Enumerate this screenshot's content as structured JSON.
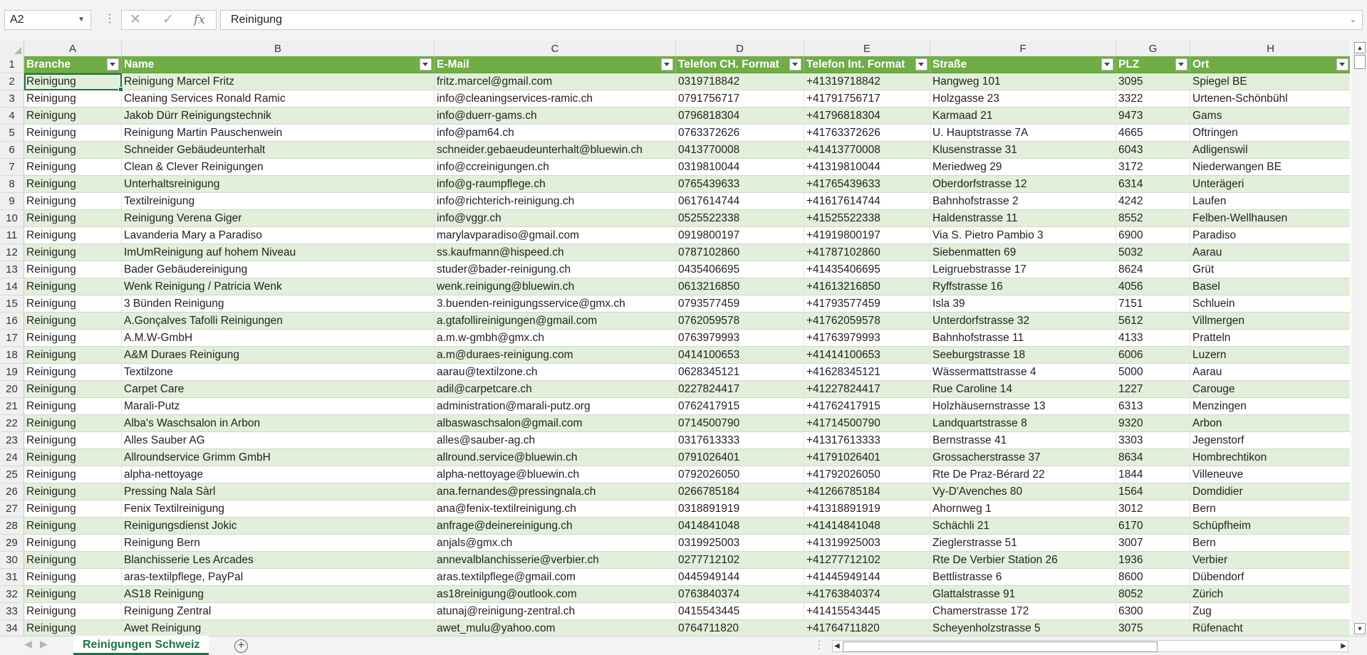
{
  "formula_bar": {
    "name_box": "A2",
    "more_icon": "⋮",
    "cancel_icon": "✕",
    "enter_icon": "✓",
    "fx_icon": "fx",
    "formula": "Reinigung"
  },
  "columns": [
    "A",
    "B",
    "C",
    "D",
    "E",
    "F",
    "G",
    "H"
  ],
  "table": {
    "headers": [
      "Branche",
      "Name",
      "E-Mail",
      "Telefon CH. Format",
      "Telefon Int. Format",
      "Straße",
      "PLZ",
      "Ort"
    ],
    "rows": [
      [
        "Reinigung",
        "Reinigung Marcel Fritz",
        "fritz.marcel@gmail.com",
        "0319718842",
        "+41319718842",
        "Hangweg 101",
        "3095",
        "Spiegel BE"
      ],
      [
        "Reinigung",
        "Cleaning Services Ronald Ramic",
        "info@cleaningservices-ramic.ch",
        "0791756717",
        "+41791756717",
        "Holzgasse 23",
        "3322",
        "Urtenen-Schönbühl"
      ],
      [
        "Reinigung",
        "Jakob Dürr Reinigungstechnik",
        "info@duerr-gams.ch",
        "0796818304",
        "+41796818304",
        "Karmaad 21",
        "9473",
        "Gams"
      ],
      [
        "Reinigung",
        "Reinigung Martin Pauschenwein",
        "info@pam64.ch",
        "0763372626",
        "+41763372626",
        "U. Hauptstrasse 7A",
        "4665",
        "Oftringen"
      ],
      [
        "Reinigung",
        "Schneider Gebäudeunterhalt",
        "schneider.gebaeudeunterhalt@bluewin.ch",
        "0413770008",
        "+41413770008",
        "Klusenstrasse 31",
        "6043",
        "Adligenswil"
      ],
      [
        "Reinigung",
        "Clean & Clever Reinigungen",
        "info@ccreinigungen.ch",
        "0319810044",
        "+41319810044",
        "Meriedweg 29",
        "3172",
        "Niederwangen BE"
      ],
      [
        "Reinigung",
        "Unterhaltsreinigung",
        "info@g-raumpflege.ch",
        "0765439633",
        "+41765439633",
        "Oberdorfstrasse 12",
        "6314",
        "Unterägeri"
      ],
      [
        "Reinigung",
        "Textilreinigung",
        "info@richterich-reinigung.ch",
        "0617614744",
        "+41617614744",
        "Bahnhofstrasse 2",
        "4242",
        "Laufen"
      ],
      [
        "Reinigung",
        "Reinigung Verena Giger",
        "info@vggr.ch",
        "0525522338",
        "+41525522338",
        "Haldenstrasse 11",
        "8552",
        "Felben-Wellhausen"
      ],
      [
        "Reinigung",
        "Lavanderia Mary a Paradiso",
        "marylavparadiso@gmail.com",
        "0919800197",
        "+41919800197",
        "Via S. Pietro Pambio 3",
        "6900",
        "Paradiso"
      ],
      [
        "Reinigung",
        "ImUmReinigung auf hohem Niveau",
        "ss.kaufmann@hispeed.ch",
        "0787102860",
        "+41787102860",
        "Siebenmatten 69",
        "5032",
        "Aarau"
      ],
      [
        "Reinigung",
        "Bader Gebäudereinigung",
        "studer@bader-reinigung.ch",
        "0435406695",
        "+41435406695",
        "Leigruebstrasse 17",
        "8624",
        "Grüt"
      ],
      [
        "Reinigung",
        "Wenk Reinigung / Patricia Wenk",
        "wenk.reinigung@bluewin.ch",
        "0613216850",
        "+41613216850",
        "Ryffstrasse 16",
        "4056",
        "Basel"
      ],
      [
        "Reinigung",
        "3 Bünden Reinigung",
        "3.buenden-reinigungsservice@gmx.ch",
        "0793577459",
        "+41793577459",
        "Isla 39",
        "7151",
        "Schluein"
      ],
      [
        "Reinigung",
        "A.Gonçalves Tafolli Reinigungen",
        "a.gtafollireinigungen@gmail.com",
        "0762059578",
        "+41762059578",
        "Unterdorfstrasse 32",
        "5612",
        "Villmergen"
      ],
      [
        "Reinigung",
        "A.M.W-GmbH",
        "a.m.w-gmbh@gmx.ch",
        "0763979993",
        "+41763979993",
        "Bahnhofstrasse 11",
        "4133",
        "Pratteln"
      ],
      [
        "Reinigung",
        "A&M Duraes Reinigung",
        "a.m@duraes-reinigung.com",
        "0414100653",
        "+41414100653",
        "Seeburgstrasse 18",
        "6006",
        "Luzern"
      ],
      [
        "Reinigung",
        "Textilzone",
        "aarau@textilzone.ch",
        "0628345121",
        "+41628345121",
        "Wässermattstrasse 4",
        "5000",
        "Aarau"
      ],
      [
        "Reinigung",
        "Carpet Care",
        "adil@carpetcare.ch",
        "0227824417",
        "+41227824417",
        "Rue Caroline 14",
        "1227",
        "Carouge"
      ],
      [
        "Reinigung",
        "Marali-Putz",
        "administration@marali-putz.org",
        "0762417915",
        "+41762417915",
        "Holzhäusernstrasse 13",
        "6313",
        "Menzingen"
      ],
      [
        "Reinigung",
        "Alba's Waschsalon in Arbon",
        "albaswaschsalon@gmail.com",
        "0714500790",
        "+41714500790",
        "Landquartstrasse 8",
        "9320",
        "Arbon"
      ],
      [
        "Reinigung",
        "Alles Sauber AG",
        "alles@sauber-ag.ch",
        "0317613333",
        "+41317613333",
        "Bernstrasse 41",
        "3303",
        "Jegenstorf"
      ],
      [
        "Reinigung",
        "Allroundservice Grimm GmbH",
        "allround.service@bluewin.ch",
        "0791026401",
        "+41791026401",
        "Grossacherstrasse 37",
        "8634",
        "Hombrechtikon"
      ],
      [
        "Reinigung",
        "alpha-nettoyage",
        "alpha-nettoyage@bluewin.ch",
        "0792026050",
        "+41792026050",
        "Rte De Praz-Bérard 22",
        "1844",
        "Villeneuve"
      ],
      [
        "Reinigung",
        "Pressing Nala Sàrl",
        "ana.fernandes@pressingnala.ch",
        "0266785184",
        "+41266785184",
        "Vy-D'Avenches 80",
        "1564",
        "Domdidier"
      ],
      [
        "Reinigung",
        "Fenix Textilreinigung",
        "ana@fenix-textilreinigung.ch",
        "0318891919",
        "+41318891919",
        "Ahornweg 1",
        "3012",
        "Bern"
      ],
      [
        "Reinigung",
        "Reinigungsdienst Jokic",
        "anfrage@deinereinigung.ch",
        "0414841048",
        "+41414841048",
        "Schächli 21",
        "6170",
        "Schüpfheim"
      ],
      [
        "Reinigung",
        "Reinigung Bern",
        "anjals@gmx.ch",
        "0319925003",
        "+41319925003",
        "Zieglerstrasse 51",
        "3007",
        "Bern"
      ],
      [
        "Reinigung",
        "Blanchisserie Les Arcades",
        "annevalblanchisserie@verbier.ch",
        "0277712102",
        "+41277712102",
        "Rte De Verbier Station 26",
        "1936",
        "Verbier"
      ],
      [
        "Reinigung",
        "aras-textilpflege, PayPal",
        "aras.textilpflege@gmail.com",
        "0445949144",
        "+41445949144",
        "Bettlistrasse 6",
        "8600",
        "Dübendorf"
      ],
      [
        "Reinigung",
        "AS18 Reinigung",
        "as18reinigung@outlook.com",
        "0763840374",
        "+41763840374",
        "Glattalstrasse 91",
        "8052",
        "Zürich"
      ],
      [
        "Reinigung",
        "Reinigung Zentral",
        "atunaj@reinigung-zentral.ch",
        "0415543445",
        "+41415543445",
        "Chamerstrasse 172",
        "6300",
        "Zug"
      ],
      [
        "Reinigung",
        "Awet Reinigung",
        "awet_mulu@yahoo.com",
        "0764711820",
        "+41764711820",
        "Scheyenholzstrasse 5",
        "3075",
        "Rüfenacht"
      ]
    ]
  },
  "colors": {
    "header_green": "#70ad47",
    "band_green": "#e2efda",
    "excel_green": "#1e7145"
  },
  "sheet_tabs": {
    "active": "Reinigungen Schweiz",
    "add_icon": "+",
    "prev_icon": "◀",
    "next_icon": "▶",
    "more_icon": "⋮"
  },
  "icons": {
    "scroll_up": "▲",
    "scroll_down": "▼",
    "scroll_left": "◀",
    "scroll_right": "▶",
    "dropdown": "⌄"
  }
}
